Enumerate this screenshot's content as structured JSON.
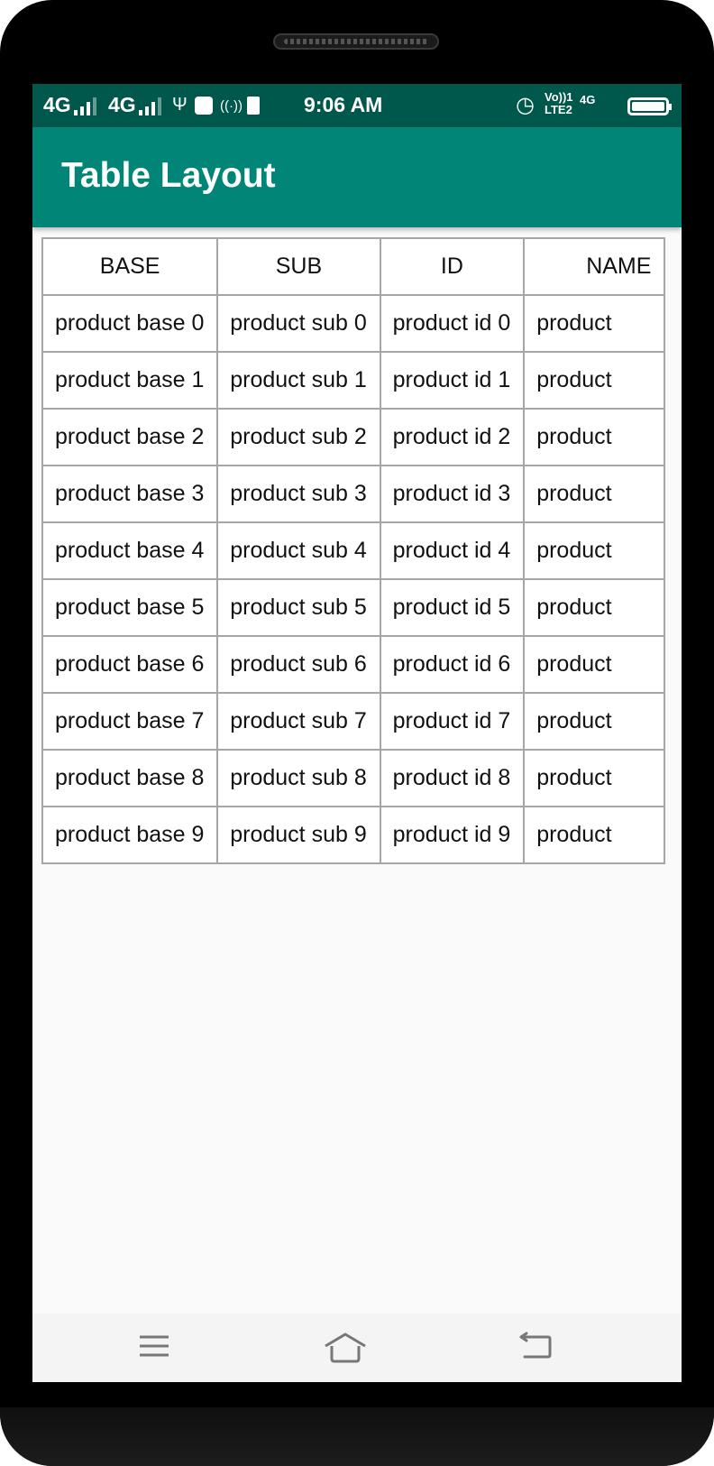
{
  "status_bar": {
    "net1": "4G",
    "net2": "4G",
    "time": "9:06 AM",
    "volte_top": "Vo))1",
    "volte_bottom": "LTE2",
    "net3": "4G"
  },
  "app_bar": {
    "title": "Table Layout"
  },
  "table": {
    "headers": [
      "BASE",
      "SUB",
      "ID",
      "NAME"
    ],
    "rows": [
      [
        "product base 0",
        "product sub 0",
        "product id 0",
        "product"
      ],
      [
        "product base 1",
        "product sub 1",
        "product id 1",
        "product"
      ],
      [
        "product base 2",
        "product sub 2",
        "product id 2",
        "product"
      ],
      [
        "product base 3",
        "product sub 3",
        "product id 3",
        "product"
      ],
      [
        "product base 4",
        "product sub 4",
        "product id 4",
        "product"
      ],
      [
        "product base 5",
        "product sub 5",
        "product id 5",
        "product"
      ],
      [
        "product base 6",
        "product sub 6",
        "product id 6",
        "product"
      ],
      [
        "product base 7",
        "product sub 7",
        "product id 7",
        "product"
      ],
      [
        "product base 8",
        "product sub 8",
        "product id 8",
        "product"
      ],
      [
        "product base 9",
        "product sub 9",
        "product id 9",
        "product"
      ]
    ]
  },
  "nav_bar": {
    "icons": [
      "menu-icon",
      "home-icon",
      "back-icon"
    ]
  },
  "colors": {
    "status_bar": "#00574b",
    "app_bar": "#008577",
    "cell_border": "#a6a6a6",
    "background": "#fafafa"
  }
}
